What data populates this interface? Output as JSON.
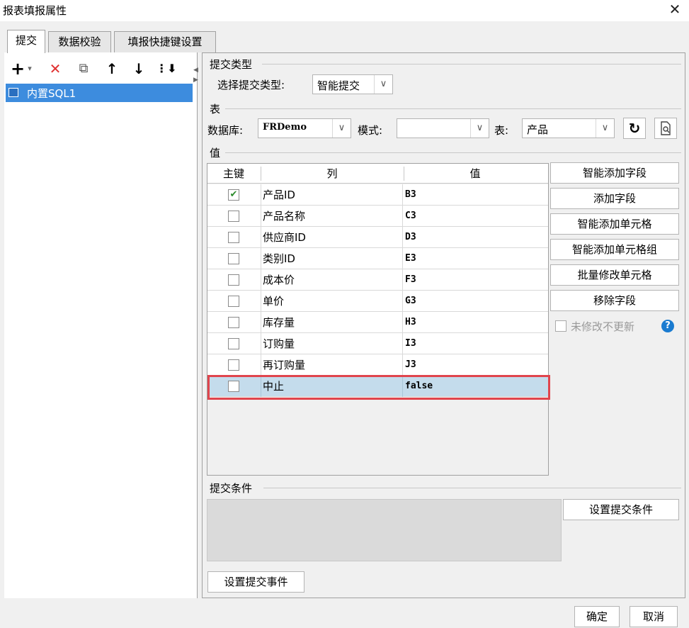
{
  "window": {
    "title": "报表填报属性",
    "close_label": "✕"
  },
  "tabs": [
    {
      "label": "提交"
    },
    {
      "label": "数据校验"
    },
    {
      "label": "填报快捷键设置"
    }
  ],
  "left": {
    "toolbar": {
      "add": "+",
      "add_drop": "▾",
      "delete": "✕",
      "copy": "⧉",
      "up": "↑",
      "down": "↓",
      "more": "⋮⬇"
    },
    "items": [
      {
        "label": "内置SQL1"
      }
    ]
  },
  "submit_type": {
    "section": "提交类型",
    "label": "选择提交类型:",
    "value": "智能提交"
  },
  "table_section": {
    "section": "表",
    "db_label": "数据库:",
    "db_value": "FRDemo",
    "mode_label": "模式:",
    "mode_value": "",
    "table_label": "表:",
    "table_value": "产品"
  },
  "values_section": {
    "section": "值",
    "headers": {
      "key": "主键",
      "column": "列",
      "value": "值"
    },
    "rows": [
      {
        "key": true,
        "column": "产品ID",
        "value": "B3"
      },
      {
        "key": false,
        "column": "产品名称",
        "value": "C3"
      },
      {
        "key": false,
        "column": "供应商ID",
        "value": "D3"
      },
      {
        "key": false,
        "column": "类别ID",
        "value": "E3"
      },
      {
        "key": false,
        "column": "成本价",
        "value": "F3"
      },
      {
        "key": false,
        "column": "单价",
        "value": "G3"
      },
      {
        "key": false,
        "column": "库存量",
        "value": "H3"
      },
      {
        "key": false,
        "column": "订购量",
        "value": "I3"
      },
      {
        "key": false,
        "column": "再订购量",
        "value": "J3"
      },
      {
        "key": false,
        "column": "中止",
        "value": "false"
      }
    ],
    "buttons": {
      "smart_add_field": "智能添加字段",
      "add_field": "添加字段",
      "smart_add_cell": "智能添加单元格",
      "smart_add_cell_group": "智能添加单元格组",
      "batch_modify_cell": "批量修改单元格",
      "remove_field": "移除字段"
    },
    "no_update_label": "未修改不更新",
    "help_icon": "?"
  },
  "condition_section": {
    "section": "提交条件",
    "set_button": "设置提交条件"
  },
  "event_button": "设置提交事件",
  "footer": {
    "ok": "确定",
    "cancel": "取消"
  },
  "colors": {
    "selection": "#3d8cde",
    "highlight_row": "#c4dcec",
    "highlight_border": "#e0454d",
    "delete_icon": "#e03030",
    "help_icon": "#1a7bd0"
  }
}
